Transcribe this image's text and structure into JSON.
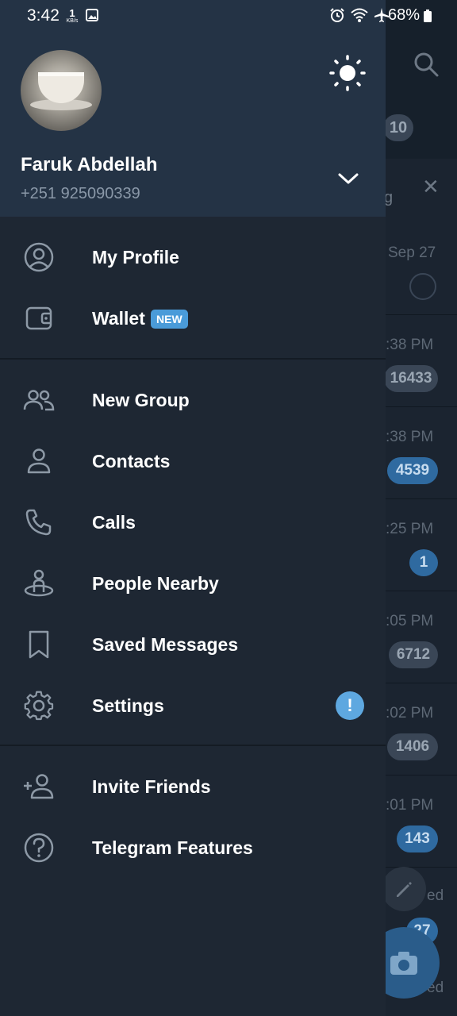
{
  "status_bar": {
    "time": "3:42",
    "net_speed_value": "1",
    "net_speed_unit": "KB/s",
    "battery": "68%"
  },
  "drawer": {
    "user_name": "Faruk Abdellah",
    "phone": "+251 925090339",
    "menu": [
      {
        "label": "My Profile",
        "icon": "profile-icon"
      },
      {
        "label": "Wallet",
        "icon": "wallet-icon",
        "badge": "NEW"
      },
      {
        "label": "New Group",
        "icon": "group-icon"
      },
      {
        "label": "Contacts",
        "icon": "contact-icon"
      },
      {
        "label": "Calls",
        "icon": "phone-icon"
      },
      {
        "label": "People Nearby",
        "icon": "people-nearby-icon"
      },
      {
        "label": "Saved Messages",
        "icon": "bookmark-icon"
      },
      {
        "label": "Settings",
        "icon": "gear-icon",
        "alert": "!"
      },
      {
        "label": "Invite Friends",
        "icon": "add-user-icon"
      },
      {
        "label": "Telegram Features",
        "icon": "question-icon"
      }
    ]
  },
  "background_chats": {
    "tab_count": "10",
    "partial_text": "g",
    "rows": [
      {
        "time": "Sep 27",
        "count": ""
      },
      {
        "time": ":38 PM",
        "count": "16433"
      },
      {
        "time": ":38 PM",
        "count": "4539"
      },
      {
        "time": ":25 PM",
        "count": "1"
      },
      {
        "time": ":05 PM",
        "count": "6712"
      },
      {
        "time": ":02 PM",
        "count": "1406"
      },
      {
        "time": ":01 PM",
        "count": "143"
      }
    ],
    "bottom_partial_1": "ed",
    "bottom_count": "27",
    "bottom_partial_2": "ed"
  }
}
